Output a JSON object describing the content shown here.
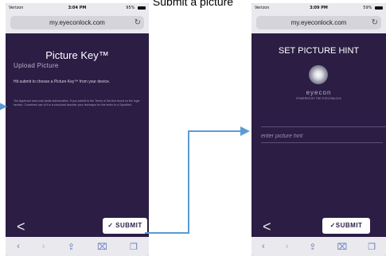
{
  "heading": "Submit a picture",
  "status_bar": {
    "carrier": "Verizon",
    "left_time": "3:04 PM",
    "right_time": "3:09 PM",
    "left_battery": "95%",
    "right_battery": "59%"
  },
  "browser": {
    "url": "my.eyeconlock.com",
    "reload_icon": "reload-icon"
  },
  "left_screen": {
    "title": "Picture Key™",
    "subtitle": "Upload Picture",
    "instruction": "Hit submit to choose a Picture Key™ from your device.",
    "fine_print": "The Applicant uses only facial authorization. If you submit to the Terms of Service found on the login section. Combined use of it is a structural decoder your technique for the techn to a Specified.",
    "back_label": "<",
    "submit_label": "✓ SUBMIT"
  },
  "right_screen": {
    "title": "SET PICTURE HINT",
    "logo_text": "eyecon",
    "logo_small": "POWERED BY THE EYECONLOCK",
    "hint_placeholder": "enter picture hint",
    "back_label": "<",
    "submit_label": "✓SUBMIT"
  },
  "toolbar_icons": [
    "back-arrow-icon",
    "forward-arrow-icon",
    "share-icon",
    "bookmarks-icon",
    "tabs-icon"
  ],
  "colors": {
    "app_background": "#2b1d44",
    "browser_chrome": "#e9e9ee",
    "connector_arrow": "#5b9bd5"
  }
}
